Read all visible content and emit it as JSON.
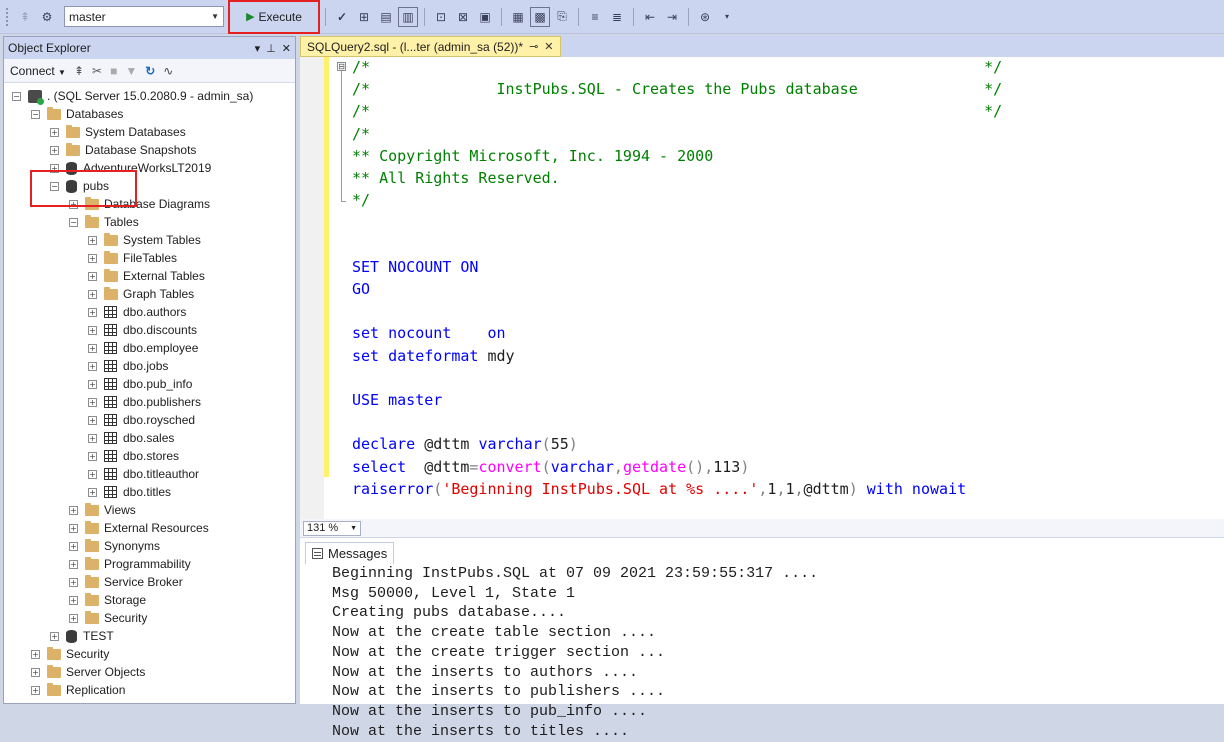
{
  "toolbar": {
    "database_value": "master",
    "execute_label": "Execute"
  },
  "object_explorer": {
    "title": "Object Explorer",
    "connect_label": "Connect",
    "tree": [
      {
        "label": ". (SQL Server 15.0.2080.9 - admin_sa)",
        "icon": "server-icon",
        "expander": "⊟",
        "depth": 0
      },
      {
        "label": "Databases",
        "icon": "folder-icon",
        "expander": "⊟",
        "depth": 1
      },
      {
        "label": "System Databases",
        "icon": "folder-icon",
        "expander": "⊞",
        "depth": 2
      },
      {
        "label": "Database Snapshots",
        "icon": "folder-icon",
        "expander": "⊞",
        "depth": 2
      },
      {
        "label": "AdventureWorksLT2019",
        "icon": "database-icon",
        "expander": "⊞",
        "depth": 2
      },
      {
        "label": "pubs",
        "icon": "database-icon",
        "expander": "⊟",
        "depth": 2
      },
      {
        "label": "Database Diagrams",
        "icon": "folder-icon",
        "expander": "⊞",
        "depth": 3
      },
      {
        "label": "Tables",
        "icon": "folder-icon",
        "expander": "⊟",
        "depth": 3
      },
      {
        "label": "System Tables",
        "icon": "folder-icon",
        "expander": "⊞",
        "depth": 4
      },
      {
        "label": "FileTables",
        "icon": "folder-icon",
        "expander": "⊞",
        "depth": 4
      },
      {
        "label": "External Tables",
        "icon": "folder-icon",
        "expander": "⊞",
        "depth": 4
      },
      {
        "label": "Graph Tables",
        "icon": "folder-icon",
        "expander": "⊞",
        "depth": 4
      },
      {
        "label": "dbo.authors",
        "icon": "table-icon",
        "expander": "⊞",
        "depth": 4
      },
      {
        "label": "dbo.discounts",
        "icon": "table-icon",
        "expander": "⊞",
        "depth": 4
      },
      {
        "label": "dbo.employee",
        "icon": "table-icon",
        "expander": "⊞",
        "depth": 4
      },
      {
        "label": "dbo.jobs",
        "icon": "table-icon",
        "expander": "⊞",
        "depth": 4
      },
      {
        "label": "dbo.pub_info",
        "icon": "table-icon",
        "expander": "⊞",
        "depth": 4
      },
      {
        "label": "dbo.publishers",
        "icon": "table-icon",
        "expander": "⊞",
        "depth": 4
      },
      {
        "label": "dbo.roysched",
        "icon": "table-icon",
        "expander": "⊞",
        "depth": 4
      },
      {
        "label": "dbo.sales",
        "icon": "table-icon",
        "expander": "⊞",
        "depth": 4
      },
      {
        "label": "dbo.stores",
        "icon": "table-icon",
        "expander": "⊞",
        "depth": 4
      },
      {
        "label": "dbo.titleauthor",
        "icon": "table-icon",
        "expander": "⊞",
        "depth": 4
      },
      {
        "label": "dbo.titles",
        "icon": "table-icon",
        "expander": "⊞",
        "depth": 4
      },
      {
        "label": "Views",
        "icon": "folder-icon",
        "expander": "⊞",
        "depth": 3
      },
      {
        "label": "External Resources",
        "icon": "folder-icon",
        "expander": "⊞",
        "depth": 3
      },
      {
        "label": "Synonyms",
        "icon": "folder-icon",
        "expander": "⊞",
        "depth": 3
      },
      {
        "label": "Programmability",
        "icon": "folder-icon",
        "expander": "⊞",
        "depth": 3
      },
      {
        "label": "Service Broker",
        "icon": "folder-icon",
        "expander": "⊞",
        "depth": 3
      },
      {
        "label": "Storage",
        "icon": "folder-icon",
        "expander": "⊞",
        "depth": 3
      },
      {
        "label": "Security",
        "icon": "folder-icon",
        "expander": "⊞",
        "depth": 3
      },
      {
        "label": "TEST",
        "icon": "database-icon",
        "expander": "⊞",
        "depth": 2
      },
      {
        "label": "Security",
        "icon": "folder-icon",
        "expander": "⊞",
        "depth": 1
      },
      {
        "label": "Server Objects",
        "icon": "folder-icon",
        "expander": "⊞",
        "depth": 1
      },
      {
        "label": "Replication",
        "icon": "folder-icon",
        "expander": "⊞",
        "depth": 1
      }
    ]
  },
  "editor": {
    "tab_label": "SQLQuery2.sql - (l...ter (admin_sa (52))*",
    "collapse_glyph": "⊟",
    "code_lines": [
      [
        {
          "t": "/*                                                                    */",
          "c": "cm"
        }
      ],
      [
        {
          "t": "/*              InstPubs.SQL - Creates the Pubs database              */",
          "c": "cm"
        }
      ],
      [
        {
          "t": "/*                                                                    */",
          "c": "cm"
        }
      ],
      [
        {
          "t": "/*",
          "c": "cm"
        }
      ],
      [
        {
          "t": "** Copyright Microsoft, Inc. 1994 - 2000",
          "c": "cm"
        }
      ],
      [
        {
          "t": "** All Rights Reserved.",
          "c": "cm"
        }
      ],
      [
        {
          "t": "*/",
          "c": "cm"
        }
      ],
      [],
      [],
      [
        {
          "t": "SET NOCOUNT ON",
          "c": "kw"
        }
      ],
      [
        {
          "t": "GO",
          "c": "kw"
        }
      ],
      [],
      [
        {
          "t": "set nocount    on",
          "c": "kw"
        }
      ],
      [
        {
          "t": "set dateformat ",
          "c": "kw"
        },
        {
          "t": "mdy",
          "c": "nm"
        }
      ],
      [],
      [
        {
          "t": "USE ",
          "c": "kw"
        },
        {
          "t": "master",
          "c": "kw"
        }
      ],
      [],
      [
        {
          "t": "declare ",
          "c": "kw"
        },
        {
          "t": "@dttm ",
          "c": "nm"
        },
        {
          "t": "varchar",
          "c": "kw"
        },
        {
          "t": "(",
          "c": "gr"
        },
        {
          "t": "55",
          "c": "nm"
        },
        {
          "t": ")",
          "c": "gr"
        }
      ],
      [
        {
          "t": "select  ",
          "c": "kw"
        },
        {
          "t": "@dttm",
          "c": "nm"
        },
        {
          "t": "=",
          "c": "gr"
        },
        {
          "t": "convert",
          "c": "fn"
        },
        {
          "t": "(",
          "c": "gr"
        },
        {
          "t": "varchar",
          "c": "kw"
        },
        {
          "t": ",",
          "c": "gr"
        },
        {
          "t": "getdate",
          "c": "fn"
        },
        {
          "t": "(),",
          "c": "gr"
        },
        {
          "t": "113",
          "c": "nm"
        },
        {
          "t": ")",
          "c": "gr"
        }
      ],
      [
        {
          "t": "raiserror",
          "c": "kw"
        },
        {
          "t": "(",
          "c": "gr"
        },
        {
          "t": "'Beginning InstPubs.SQL at %s ....'",
          "c": "st"
        },
        {
          "t": ",",
          "c": "gr"
        },
        {
          "t": "1",
          "c": "nm"
        },
        {
          "t": ",",
          "c": "gr"
        },
        {
          "t": "1",
          "c": "nm"
        },
        {
          "t": ",",
          "c": "gr"
        },
        {
          "t": "@dttm",
          "c": "nm"
        },
        {
          "t": ") ",
          "c": "gr"
        },
        {
          "t": "with nowait",
          "c": "kw"
        }
      ]
    ],
    "zoom": "131 %"
  },
  "results": {
    "tab_label": "Messages",
    "messages": [
      "Beginning InstPubs.SQL at 07 09 2021 23:59:55:317 ....",
      "Msg 50000, Level 1, State 1",
      "Creating pubs database....",
      "Now at the create table section ....",
      "Now at the create trigger section ...",
      "Now at the inserts to authors ....",
      "Now at the inserts to publishers ....",
      "Now at the inserts to pub_info ....",
      "Now at the inserts to titles ...."
    ]
  }
}
